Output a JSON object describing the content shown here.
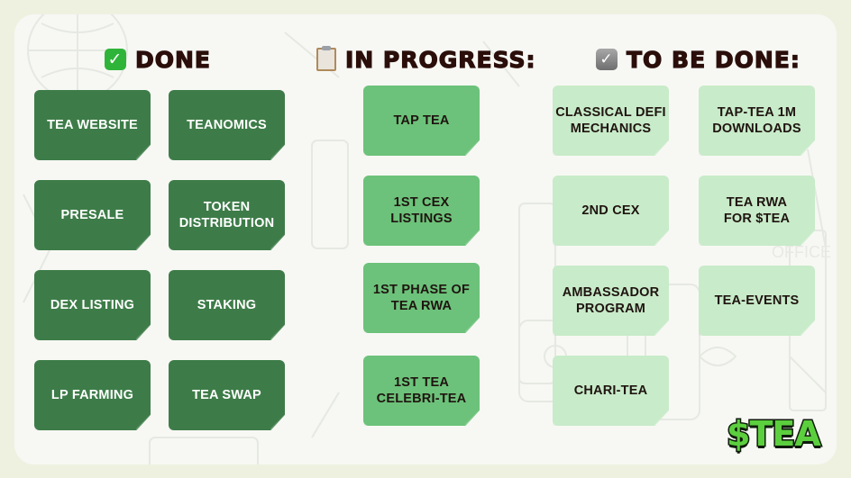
{
  "columns": {
    "done": {
      "title": "DONE",
      "icon": "check-box-green-icon",
      "items": [
        "TEA WEBSITE",
        "TEANOMICS",
        "PRESALE",
        "TOKEN DISTRIBUTION",
        "DEX LISTING",
        "STAKING",
        "LP FARMING",
        "TEA SWAP"
      ]
    },
    "in_progress": {
      "title": "IN PROGRESS:",
      "icon": "clipboard-icon",
      "items": [
        "TAP TEA",
        "1ST CEX LISTINGS",
        "1ST PHASE OF TEA RWA",
        "1ST TEA CELEBRI-TEA"
      ]
    },
    "to_be_done": {
      "title": "TO BE DONE:",
      "icon": "check-box-gray-icon",
      "items": [
        "CLASSICAL DEFI MECHANICS",
        "TAP-TEA 1M DOWNLOADS",
        "2ND CEX",
        "TEA RWA FOR $TEA",
        "AMBASSADOR PROGRAM",
        "TEA-EVENTS",
        "CHARI-TEA"
      ]
    }
  },
  "logo": {
    "text": "$TEA"
  },
  "colors": {
    "done_note": "#3d7c48",
    "progress_note": "#6cc27a",
    "todo_note": "#c8ebc9",
    "heading_text": "#2b0e0a"
  }
}
